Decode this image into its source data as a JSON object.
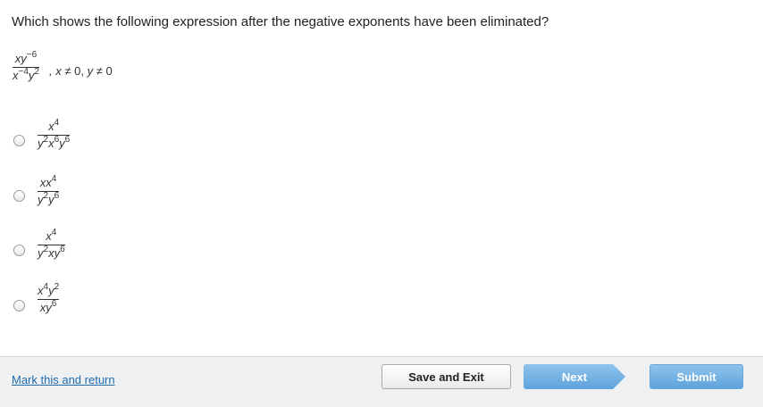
{
  "question": {
    "text": "Which shows the following expression after the negative exponents have been eliminated?"
  },
  "expression": {
    "numerator": {
      "base1": "xy",
      "exp1": "−6"
    },
    "denominator": {
      "base1": "x",
      "exp1": "−4",
      "base2": "y",
      "exp2": "2"
    },
    "trailing_comma": ",",
    "condition1_var": "x",
    "condition1_rel": " ≠ ",
    "condition1_val": "0",
    "separator": ", ",
    "condition2_var": "y",
    "condition2_rel": " ≠ ",
    "condition2_val": "0"
  },
  "options": [
    {
      "numerator": {
        "b1": "x",
        "e1": "4"
      },
      "denominator": {
        "b1": "y",
        "e1": "2",
        "b2": "x",
        "e2": "6",
        "b3": "y",
        "e3": "6"
      }
    },
    {
      "numerator": {
        "b1": "xx",
        "e1": "4"
      },
      "denominator": {
        "b1": "y",
        "e1": "2",
        "b2": "y",
        "e2": "6"
      }
    },
    {
      "numerator": {
        "b1": "x",
        "e1": "4"
      },
      "denominator": {
        "b1": "y",
        "e1": "2",
        "b2": "xy",
        "e2": "6"
      }
    },
    {
      "numerator": {
        "b1": "x",
        "e1": "4",
        "b2": "y",
        "e2": "2"
      },
      "denominator": {
        "b1": "xy",
        "e1": "6"
      }
    }
  ],
  "footer": {
    "mark_link": "Mark this and return",
    "save_exit": "Save and Exit",
    "next": "Next",
    "submit": "Submit"
  }
}
